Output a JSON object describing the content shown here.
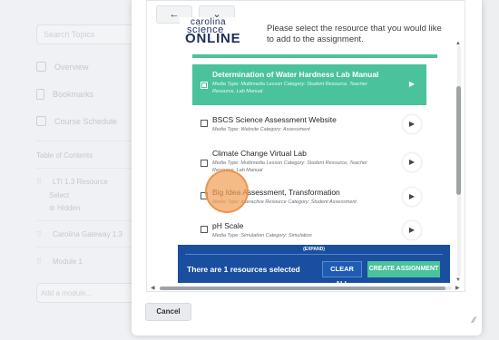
{
  "background": {
    "search_placeholder": "Search Topics",
    "nav": [
      {
        "label": "Overview",
        "icon": "overview-icon"
      },
      {
        "label": "Bookmarks",
        "icon": "bookmark-icon"
      },
      {
        "label": "Course Schedule",
        "icon": "calendar-icon"
      }
    ],
    "toc_label": "Table of Contents",
    "modules": [
      {
        "title": "LTI 1.3 Resource",
        "line2": "Select",
        "status": "Hidden"
      },
      {
        "title": "Carolina Gateway 1.3"
      },
      {
        "title": "Module 1"
      }
    ],
    "add_module_placeholder": "Add a module..."
  },
  "dialog": {
    "back_glyph": "←",
    "down_glyph": "⌄",
    "logo": {
      "line1": "carolina",
      "line2": "science",
      "line3": "ONLINE"
    },
    "prompt": "Please select the resource that you would like to add to the assignment.",
    "accent_color": "#4ac29b",
    "footer_color": "#1a4fa0",
    "items": [
      {
        "title": "Determination of Water Hardness Lab Manual",
        "meta": "Media Type: Multimedia Lesson Category: Student Resource, Teacher Resource, Lab Manual",
        "selected": true
      },
      {
        "title": "BSCS Science Assessment Website",
        "meta": "Media Type: Website Category: Assessment",
        "selected": false
      },
      {
        "title": "Climate Change Virtual Lab",
        "meta": "Media Type: Multimedia Lesson Category: Student Resource, Teacher Resource, Lab Manual",
        "selected": false
      },
      {
        "title": "Big Idea Assessment, Transformation",
        "meta": "Media Type: Interactive Resource Category: Student Assessment",
        "selected": false
      },
      {
        "title": "pH Scale",
        "meta": "Media Type: Simulation Category: Simulation",
        "selected": false
      }
    ],
    "play_glyph": "▶",
    "expand_label": "(EXPAND)",
    "selection_text": "There are 1 resources selected",
    "clear_all_label": "CLEAR ALL",
    "create_label": "CREATE ASSIGNMENT",
    "cancel_label": "Cancel",
    "resize_glyph": "⁄⁄"
  }
}
